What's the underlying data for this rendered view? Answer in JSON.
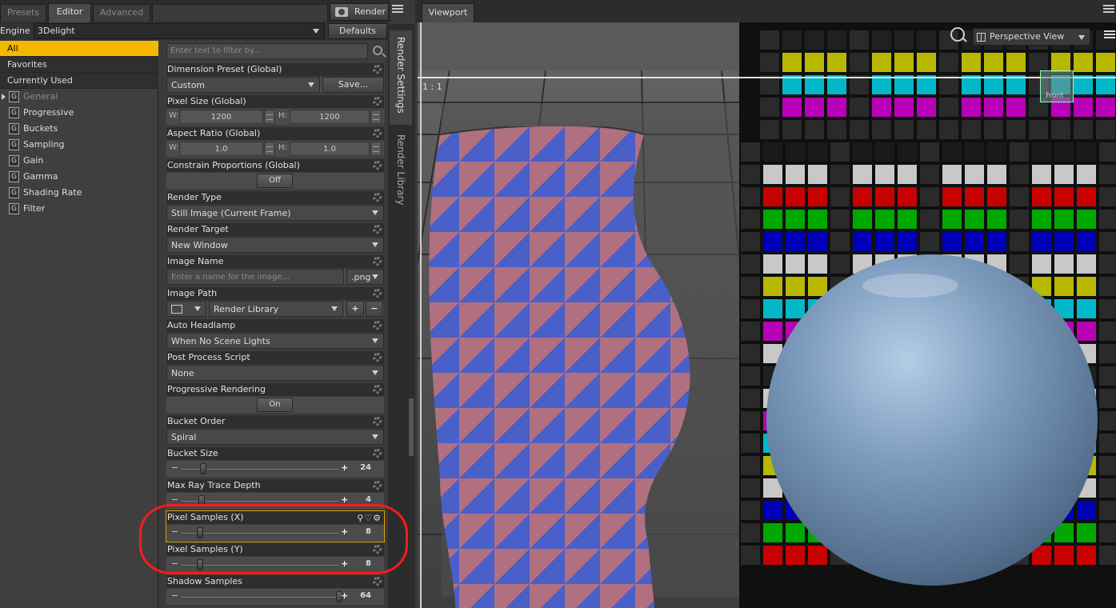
{
  "panel_tabs": [
    {
      "label": "Presets",
      "active": false
    },
    {
      "label": "Editor",
      "active": true
    },
    {
      "label": "Advanced",
      "active": false
    }
  ],
  "render_button": {
    "label": "Render",
    "icon": "camera-icon"
  },
  "engine": {
    "label": "Engine :",
    "value": "3Delight"
  },
  "defaults_button": "Defaults",
  "categories": {
    "all": "All",
    "favorites": "Favorites",
    "currently_used": "Currently Used",
    "general": "General",
    "groups": [
      "Progressive",
      "Buckets",
      "Sampling",
      "Gain",
      "Gamma",
      "Shading Rate",
      "Filter"
    ],
    "group_icon_letter": "G"
  },
  "filter": {
    "placeholder": "Enter text to filter by..."
  },
  "props": {
    "dimension_preset": {
      "title": "Dimension Preset (Global)",
      "value": "Custom",
      "button": "Save..."
    },
    "pixel_size": {
      "title": "Pixel Size (Global)",
      "w_label": "W:",
      "w": "1200",
      "h_label": "H:",
      "h": "1200"
    },
    "aspect_ratio": {
      "title": "Aspect Ratio (Global)",
      "w_label": "W:",
      "w": "1.0",
      "h_label": "H:",
      "h": "1.0"
    },
    "constrain": {
      "title": "Constrain Proportions (Global)",
      "value": "Off"
    },
    "render_type": {
      "title": "Render Type",
      "value": "Still Image (Current Frame)"
    },
    "render_target": {
      "title": "Render Target",
      "value": "New Window"
    },
    "image_name": {
      "title": "Image Name",
      "placeholder": "Enter a name for the image...",
      "ext": ".png"
    },
    "image_path": {
      "title": "Image Path",
      "value": "Render Library",
      "add": "+",
      "remove": "−"
    },
    "auto_headlamp": {
      "title": "Auto Headlamp",
      "value": "When No Scene Lights"
    },
    "post_process": {
      "title": "Post Process Script",
      "value": "None"
    },
    "progressive": {
      "title": "Progressive Rendering",
      "value": "On"
    },
    "bucket_order": {
      "title": "Bucket Order",
      "value": "Spiral"
    },
    "bucket_size": {
      "title": "Bucket Size",
      "value": "24",
      "level": 0.12
    },
    "max_ray": {
      "title": "Max Ray Trace Depth",
      "value": "4",
      "level": 0.11
    },
    "pixel_samples_x": {
      "title": "Pixel Samples (X)",
      "value": "8",
      "level": 0.1
    },
    "pixel_samples_y": {
      "title": "Pixel Samples (Y)",
      "value": "8",
      "level": 0.1
    },
    "shadow_samples": {
      "title": "Shadow Samples",
      "value": "64",
      "level": 0.99
    }
  },
  "slider_minus": "−",
  "slider_plus": "+",
  "vertical_tabs": [
    "Render Settings",
    "Render Library"
  ],
  "viewport": {
    "tab": "Viewport",
    "view": "Perspective View",
    "ratio": "1 : 1",
    "cube_label": "Front",
    "colors": {
      "vase_blue": "#4a5fc8",
      "vase_red": "#b07080",
      "sphere": "#7d9bbd",
      "highlight_outline": "#d8a200",
      "annotation": "#ff1a1a",
      "category_selected": "#f5b800"
    }
  }
}
